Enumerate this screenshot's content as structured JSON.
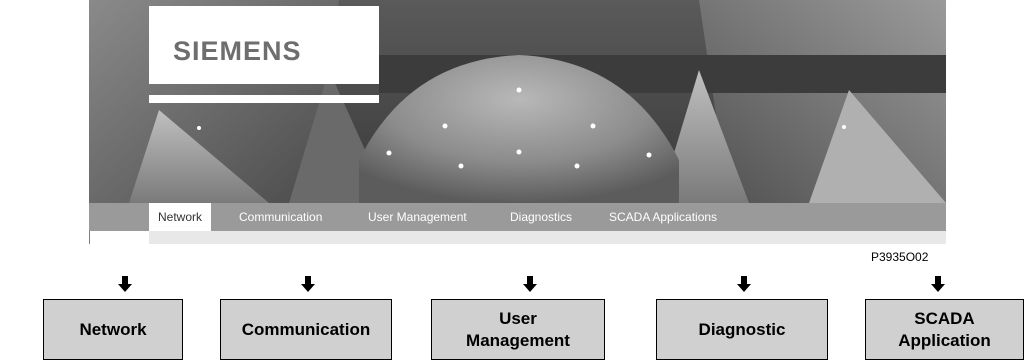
{
  "banner": {
    "logo": "SIEMENS",
    "nav": [
      {
        "label": "Network",
        "active": true
      },
      {
        "label": "Communication",
        "active": false
      },
      {
        "label": "User Management",
        "active": false
      },
      {
        "label": "Diagnostics",
        "active": false
      },
      {
        "label": "SCADA Applications",
        "active": false
      }
    ]
  },
  "figure_code": "P3935O02",
  "boxes": [
    {
      "label": "Network"
    },
    {
      "label": "Communication"
    },
    {
      "label": "User\nManagement"
    },
    {
      "label": "Diagnostic"
    },
    {
      "label": "SCADA\nApplication"
    }
  ],
  "colors": {
    "box_fill": "#d0d0d0",
    "navbar": "#9a9a9a",
    "logo_text": "#6e6e6e"
  }
}
